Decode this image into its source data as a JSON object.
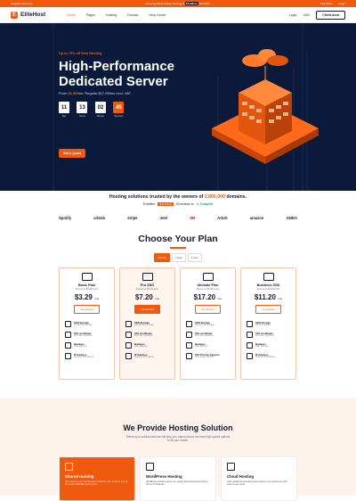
{
  "topbar": {
    "email": "info@domain.com",
    "promo_pre": "Running Black Friday Starting At",
    "promo_price": "$3.99/mo",
    "promo_post": "Get Offer",
    "live_chat": "Live Chat",
    "login": "Login"
  },
  "nav": {
    "brand": "EliteHost",
    "items": [
      "Home",
      "Pages",
      "Hosting",
      "Domain",
      "Help Center"
    ],
    "login": "Login",
    "currency": "USD",
    "cta": "Client Area"
  },
  "hero": {
    "promo": "Up to 75% off Web Hosting",
    "title": "High-Performance Dedicated Server",
    "price_pre": "From ",
    "price_value": "$3.99",
    "price_post": "/mo. Regular $17.99/mo excl. VAT",
    "countdown": [
      {
        "value": "11",
        "label": "Day"
      },
      {
        "value": "13",
        "label": "Hours"
      },
      {
        "value": "02",
        "label": "Minute"
      },
      {
        "value": "45",
        "label": "Seconds"
      }
    ],
    "cta": "Get a Quote"
  },
  "trust": {
    "heading_pre": "Hosting solutions trusted by the owners of ",
    "heading_num": "2,800,000",
    "heading_post": " domains.",
    "excellent": "Excellent",
    "stars": "★★★★★",
    "reviews": "90 reviews on",
    "trustpilot": "★ Trustpilot",
    "logos": [
      "Spotify",
      "airbnb",
      "stripe",
      "intel",
      "3M",
      "ASUS",
      "amazon",
      "AMDA"
    ]
  },
  "plans": {
    "title": "Choose Your Plan",
    "tabs": [
      "Monthly",
      "Yearly",
      "3 Year"
    ],
    "cards": [
      {
        "name": "Basic Plan",
        "renew": "Renews at $5.99/month",
        "price": "$3.29",
        "unit": "/mo",
        "cta": "Get Started",
        "features": [
          [
            "SSD Storage",
            "50 GB SSD Storage"
          ],
          [
            "SSL Certificate",
            "Free SSL Certificate"
          ],
          [
            "Backups",
            "Daily Backups"
          ],
          [
            "IP Address",
            "Dedicated IP Address"
          ]
        ]
      },
      {
        "name": "Pro SSD",
        "renew": "Renews at $5.99/month",
        "price": "$7.20",
        "unit": "/mo",
        "cta": "Get Started",
        "features": [
          [
            "SSD Storage",
            "100 GB SSD Storage"
          ],
          [
            "SSL Certificate",
            "Free SSL Certificate"
          ],
          [
            "Backups",
            "Daily Backups"
          ],
          [
            "IP Address",
            "Dedicated IP Address"
          ]
        ]
      },
      {
        "name": "Ultimate Plan",
        "renew": "Renews at $5.99/month",
        "price": "$17.20",
        "unit": "/mo",
        "cta": "Get Started",
        "features": [
          [
            "SSD Storage",
            "200 GB SSD Storage"
          ],
          [
            "SSL Certificate",
            "Free SSL Certificate"
          ],
          [
            "Backups",
            "Daily Backups"
          ],
          [
            "24/7 Priority Support",
            "24/7 Priority Support"
          ]
        ]
      },
      {
        "name": "Business SSD",
        "renew": "Renews at $5.99/month",
        "price": "$11.20",
        "unit": "/mo",
        "cta": "Get Started",
        "features": [
          [
            "SSD Storage",
            "NB SSD Storage"
          ],
          [
            "SSL Certificate",
            "Free SSL Certificate"
          ],
          [
            "Backups",
            "Daily Backups"
          ],
          [
            "IP Address",
            "Dedicated IP Address"
          ]
        ]
      }
    ]
  },
  "solution": {
    "title": "We Provide Hosting Solution",
    "sub": "Select your solution and we will help you narrow down our best high-speed options to fit your needs.",
    "cards": [
      {
        "title": "Shared Hosting",
        "desc": "The most popular hosting plan available and comes at one of the most affordable price points."
      },
      {
        "title": "WordPress Hosting",
        "desc": "WordPress Hosting gives you speed and performance with a full set of features."
      },
      {
        "title": "Cloud Hosting",
        "desc": "Gain additional resources and support your customers with easy-to-use tools."
      }
    ]
  },
  "colors": {
    "accent": "#f05a0f",
    "navy": "#0b1a3a",
    "cream": "#fdf3ec"
  }
}
